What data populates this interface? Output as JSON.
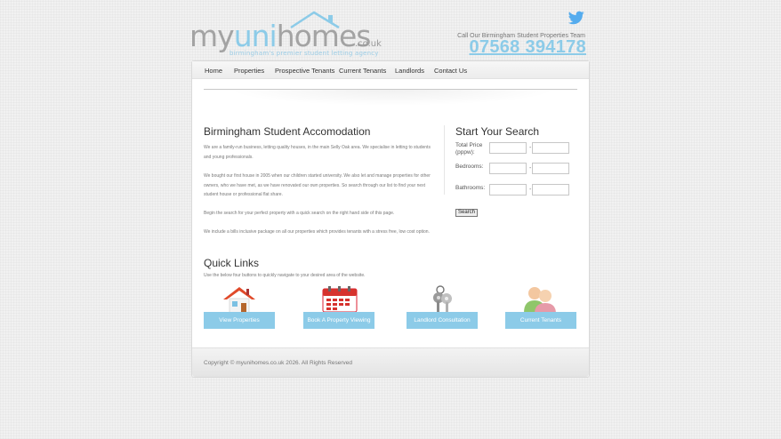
{
  "header": {
    "logo_my": "my",
    "logo_uni": "uni",
    "logo_homes": "homes",
    "logo_domain": ".co.uk",
    "logo_tagline": "birmingham's premier student letting agency",
    "call_text": "Call Our Birmingham Student Properties Team",
    "phone": "07568 394178"
  },
  "nav": {
    "items": [
      "Home",
      "Properties",
      "Prospective Tenants",
      "Current Tenants",
      "Landlords",
      "Contact Us"
    ]
  },
  "intro": {
    "title": "Birmingham Student Accomodation",
    "paragraphs": [
      "We are a family-run business, letting quality houses, in the main Selly Oak area. We specialise in letting to students and young professionals.",
      "We bought our first house in 2005 when our children started university. We also let and manage properties for other owners, who we have met, as we have renovated our own properties. So search through our list to find your next student house or professional flat share.",
      "Begin the search for your perfect property with a quick search on the right hand side of this page.",
      "We include a bills inclusive package on all our properties which provides tenants with a stress free, low cost option."
    ]
  },
  "search": {
    "title": "Start Your Search",
    "price_label": "Total Price (pppw):",
    "bedrooms_label": "Bedrooms:",
    "bathrooms_label": "Bathrooms:",
    "dash": "-",
    "button_label": "Search"
  },
  "quick_links": {
    "title": "Quick Links",
    "description": "Use the below four buttons to quickly navigate to your desired area of the website.",
    "buttons": [
      "View Properties",
      "Book A Property Viewing",
      "Landlord Consultation",
      "Current Tenants"
    ]
  },
  "footer": {
    "copyright": "Copyright © myunihomes.co.uk 2026. All Rights Reserved"
  },
  "colors": {
    "accent": "#8ccbe8",
    "logo_grey": "#a3a3a3",
    "twitter_blue": "#55acee"
  }
}
